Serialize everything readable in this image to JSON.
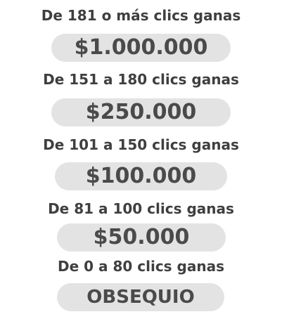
{
  "tiers": [
    {
      "label": "De 181 o más clics ganas",
      "prize": "$1.000.000"
    },
    {
      "label": "De 151 a 180 clics ganas",
      "prize": "$250.000"
    },
    {
      "label": "De 101 a 150 clics ganas",
      "prize": "$100.000"
    },
    {
      "label": "De 81 a 100 clics ganas",
      "prize": "$50.000"
    },
    {
      "label": "De 0 a 80 clics ganas",
      "prize": "OBSEQUIO"
    }
  ],
  "colors": {
    "text": "#3f3f3f",
    "pill_background": "#e3e3e3",
    "pill_text": "#4a4a4a",
    "page_background": "#ffffff"
  }
}
